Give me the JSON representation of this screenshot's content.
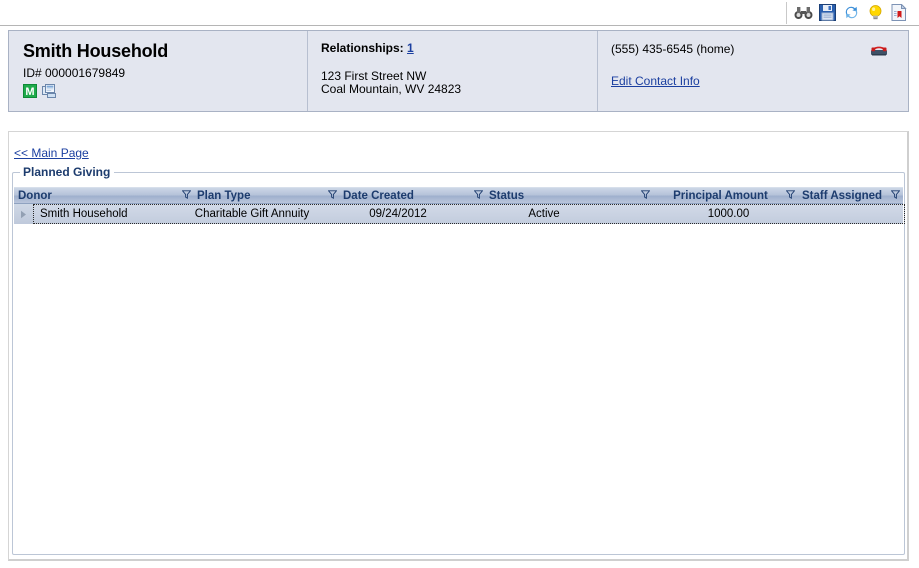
{
  "toolbar": {
    "icons": [
      {
        "name": "binoculars-icon",
        "title": "Search"
      },
      {
        "name": "save-icon",
        "title": "Save"
      },
      {
        "name": "refresh-icon",
        "title": "Refresh"
      },
      {
        "name": "lightbulb-icon",
        "title": "Tips"
      },
      {
        "name": "report-icon",
        "title": "Report"
      }
    ]
  },
  "header": {
    "household_name": "Smith Household",
    "id_label": "ID# 000001679849",
    "badges": [
      {
        "name": "membership-badge",
        "label": "M"
      },
      {
        "name": "multi-record-icon",
        "label": ""
      }
    ],
    "relationships_label": "Relationships:",
    "relationships_count": "1",
    "address_line1": "123 First Street NW",
    "address_line2": "Coal Mountain, WV 24823",
    "phone": "(555) 435-6545 (home)",
    "edit_contact_label": "Edit Contact Info"
  },
  "content": {
    "main_page_link": "<< Main Page",
    "groupbox_title": "Planned Giving"
  },
  "grid": {
    "columns": [
      {
        "label": "Donor",
        "filter": false,
        "align": "left"
      },
      {
        "label": "Plan Type",
        "filter": true,
        "align": "left"
      },
      {
        "label": "Date Created",
        "filter": true,
        "align": "left"
      },
      {
        "label": "Status",
        "filter": true,
        "align": "left"
      },
      {
        "label": "",
        "filter": true,
        "align": "left"
      },
      {
        "label": "Principal Amount",
        "filter": true,
        "align": "right"
      },
      {
        "label": "Staff Assigned",
        "filter": true,
        "align": "left"
      }
    ],
    "rows": [
      {
        "donor": "Smith Household",
        "plan_type": "Charitable Gift Annuity",
        "date_created": "09/24/2012",
        "status": "Active",
        "blank": "",
        "principal_amount": "1000.00",
        "staff_assigned": ""
      }
    ]
  },
  "colors": {
    "header_panel_bg": "#e3e6ef",
    "link": "#1b3fa0",
    "grid_header_text": "#1d3c6e",
    "badge_green": "#1faa4b",
    "phone_icon_red": "#cc1a1a"
  }
}
